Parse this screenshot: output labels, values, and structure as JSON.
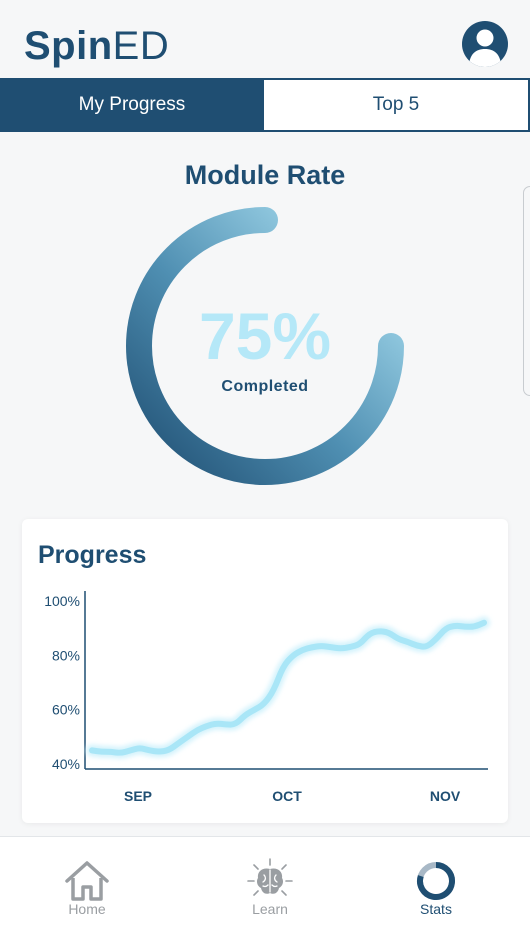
{
  "app": {
    "logo_bold": "Spin",
    "logo_regular": "ED"
  },
  "tabs": [
    {
      "label": "My Progress",
      "active": true
    },
    {
      "label": "Top 5",
      "active": false
    }
  ],
  "module_rate": {
    "title": "Module Rate",
    "percent_text": "75%",
    "percent_value": 75,
    "label": "Completed"
  },
  "progress_card": {
    "title": "Progress"
  },
  "chart_data": {
    "type": "line",
    "title": "Progress",
    "xlabel": "",
    "ylabel": "",
    "ylim": [
      40,
      100
    ],
    "y_ticks": [
      "100%",
      "80%",
      "60%",
      "40%"
    ],
    "x_ticks": [
      "SEP",
      "OCT",
      "NOV"
    ],
    "grid": false,
    "series": [
      {
        "values": [
          45,
          44.5,
          44.5,
          44,
          45,
          46,
          45,
          44.5,
          45,
          47.5,
          50,
          52.5,
          54,
          55,
          54.5,
          54.5,
          58,
          60,
          62,
          67,
          76,
          80,
          82,
          83,
          83.5,
          83,
          82.5,
          83,
          84,
          88,
          89,
          88.5,
          86,
          85,
          83.5,
          83,
          86,
          90,
          91,
          90.5,
          90.5,
          92
        ]
      }
    ]
  },
  "navbar": {
    "items": [
      {
        "label": "Home"
      },
      {
        "label": "Learn"
      },
      {
        "label": "Stats"
      }
    ]
  },
  "colors": {
    "primary": "#1f4e72",
    "accent_light": "#b5e8f8",
    "line": "#a9e6f7",
    "background": "#f6f7f8"
  }
}
